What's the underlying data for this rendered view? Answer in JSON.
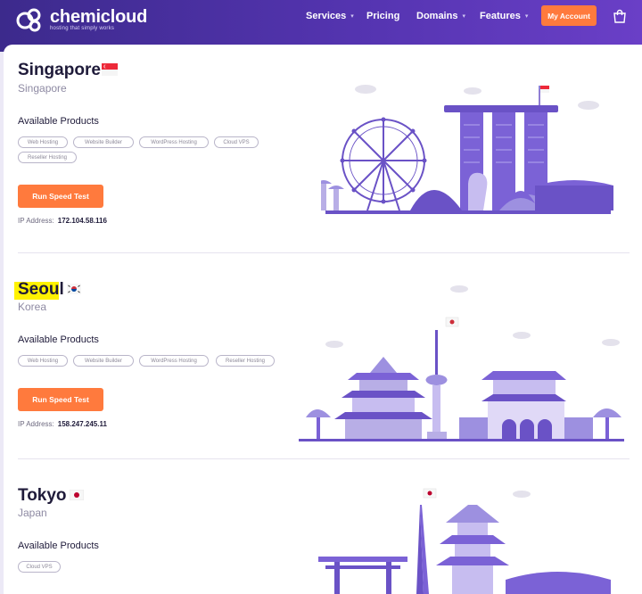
{
  "brand": {
    "name": "chemicloud",
    "tagline": "hosting that simply works"
  },
  "nav": {
    "items": [
      {
        "label": "Services",
        "has_dropdown": true
      },
      {
        "label": "Pricing",
        "has_dropdown": false
      },
      {
        "label": "Domains",
        "has_dropdown": true
      },
      {
        "label": "Features",
        "has_dropdown": true
      }
    ],
    "account_label": "My Account",
    "caret": "▾"
  },
  "colors": {
    "primary": "#5434b0",
    "accent": "#ff7a3d",
    "illustration": "#7b62d6"
  },
  "locations": [
    {
      "name": "Singapore",
      "country": "Singapore",
      "flag": "singapore-flag",
      "products_heading": "Available Products",
      "products": [
        "Web Hosting",
        "Website Builder",
        "WordPress Hosting",
        "Cloud VPS",
        "Reseller Hosting"
      ],
      "button_label": "Run Speed Test",
      "ip_label": "IP Address:",
      "ip": "172.104.58.116"
    },
    {
      "name": "Seoul",
      "country": "Korea",
      "flag": "south-korea-flag",
      "highlighted": true,
      "products_heading": "Available Products",
      "products": [
        "Web Hosting",
        "Website Builder",
        "WordPress Hosting",
        "Reseller Hosting"
      ],
      "button_label": "Run Speed Test",
      "ip_label": "IP Address:",
      "ip": "158.247.245.11"
    },
    {
      "name": "Tokyo",
      "country": "Japan",
      "flag": "japan-flag",
      "products_heading": "Available Products",
      "products": [
        "Cloud VPS"
      ]
    }
  ]
}
